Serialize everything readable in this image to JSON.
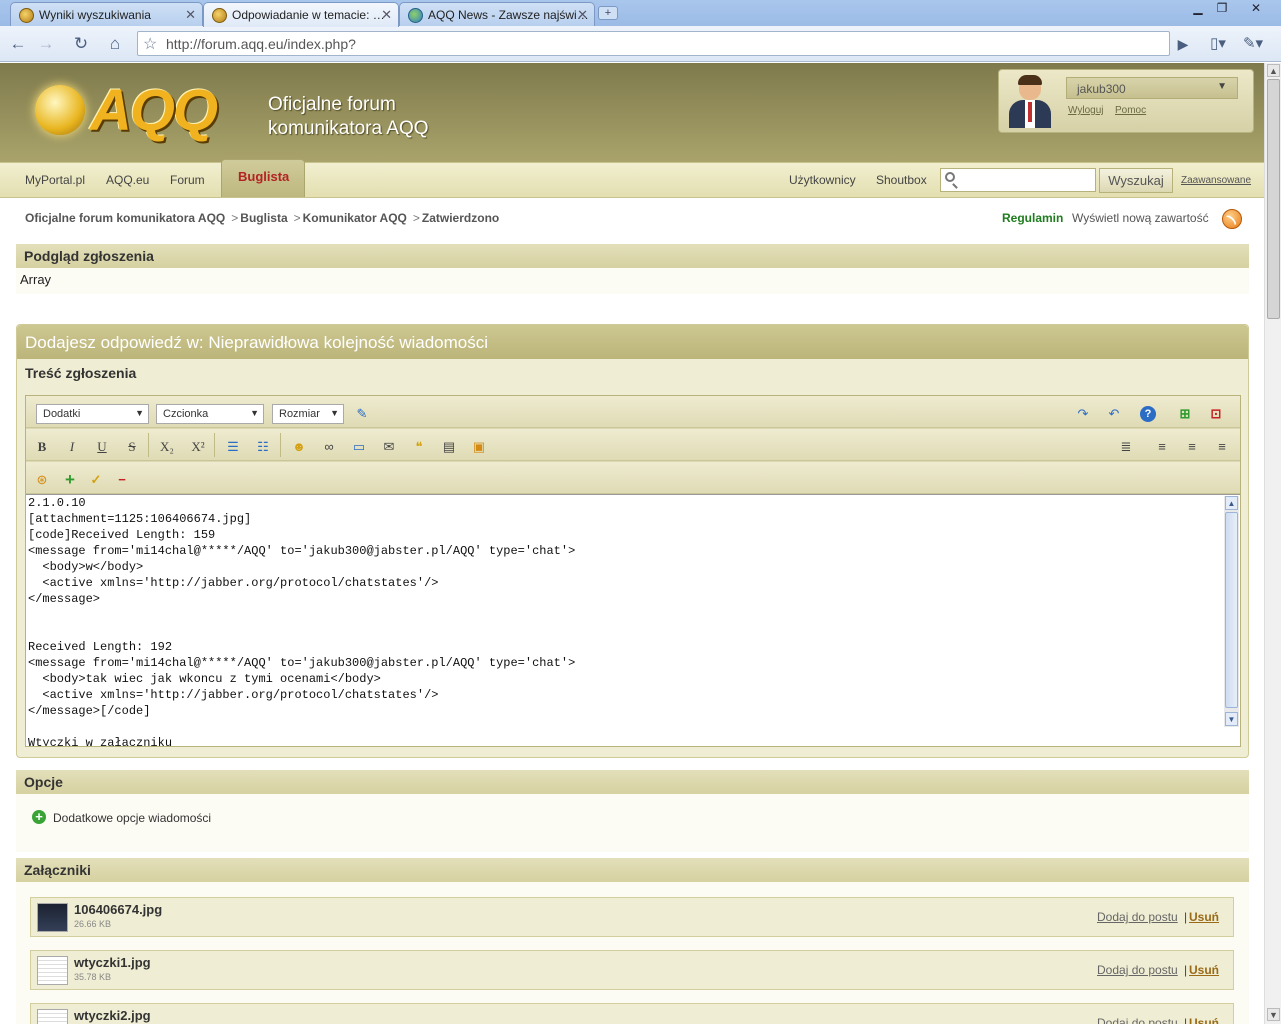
{
  "browser": {
    "tabs": [
      {
        "title": "Wyniki wyszukiwania",
        "active": false
      },
      {
        "title": "Odpowiadanie w temacie: …",
        "active": true
      },
      {
        "title": "AQQ News - Zawsze najświ…",
        "active": false
      }
    ],
    "url": "http://forum.aqq.eu/index.php?",
    "window_controls": {
      "minimize": "▁",
      "maximize": "❐",
      "close": "✕"
    }
  },
  "header": {
    "logo_text": "AQQ",
    "site_title_line1": "Oficjalne forum",
    "site_title_line2": "komunikatora AQQ",
    "user": {
      "name": "jakub300",
      "logout": "Wyloguj",
      "help": "Pomoc"
    }
  },
  "nav": {
    "left": [
      "MyPortal.pl",
      "AQQ.eu",
      "Forum",
      "Buglista"
    ],
    "right": [
      "Użytkownicy",
      "Shoutbox"
    ],
    "search_value": "",
    "search_button": "Wyszukaj",
    "advanced": "Zaawansowane"
  },
  "breadcrumb": [
    "Oficjalne forum komunikatora AQQ",
    "Buglista",
    "Komunikator AQQ",
    "Zatwierdzono"
  ],
  "breadcrumb_sep": ">",
  "links": {
    "rules": "Regulamin",
    "new_content": "Wyświetl nową zawartość"
  },
  "preview": {
    "heading": "Podgląd zgłoszenia",
    "body": "Array"
  },
  "reply": {
    "title": "Dodajesz odpowiedź w: Nieprawidłowa kolejność wiadomości",
    "content_heading": "Treść zgłoszenia",
    "dropdowns": [
      "Dodatki",
      "Czcionka",
      "Rozmiar"
    ],
    "text": "2.1.0.10\n[attachment=1125:106406674.jpg]\n[code]Received Length: 159\n<message from='mi14chal@*****/AQQ' to='jakub300@jabster.pl/AQQ' type='chat'>\n  <body>w</body>\n  <active xmlns='http://jabber.org/protocol/chatstates'/>\n</message>\n\n\nReceived Length: 192\n<message from='mi14chal@*****/AQQ' to='jakub300@jabster.pl/AQQ' type='chat'>\n  <body>tak wiec jak wkoncu z tymi ocenami</body>\n  <active xmlns='http://jabber.org/protocol/chatstates'/>\n</message>[/code]\n\nWtyczki w załączniku"
  },
  "options": {
    "heading": "Opcje",
    "more": "Dodatkowe opcje wiadomości"
  },
  "attachments": {
    "heading": "Załączniki",
    "add_label": "Dodaj do postu",
    "delete_label": "Usuń",
    "sep": "|",
    "items": [
      {
        "name": "106406674.jpg",
        "size": "26.66 KB"
      },
      {
        "name": "wtyczki1.jpg",
        "size": "35.78 KB"
      },
      {
        "name": "wtyczki2.jpg",
        "size": ""
      }
    ]
  }
}
